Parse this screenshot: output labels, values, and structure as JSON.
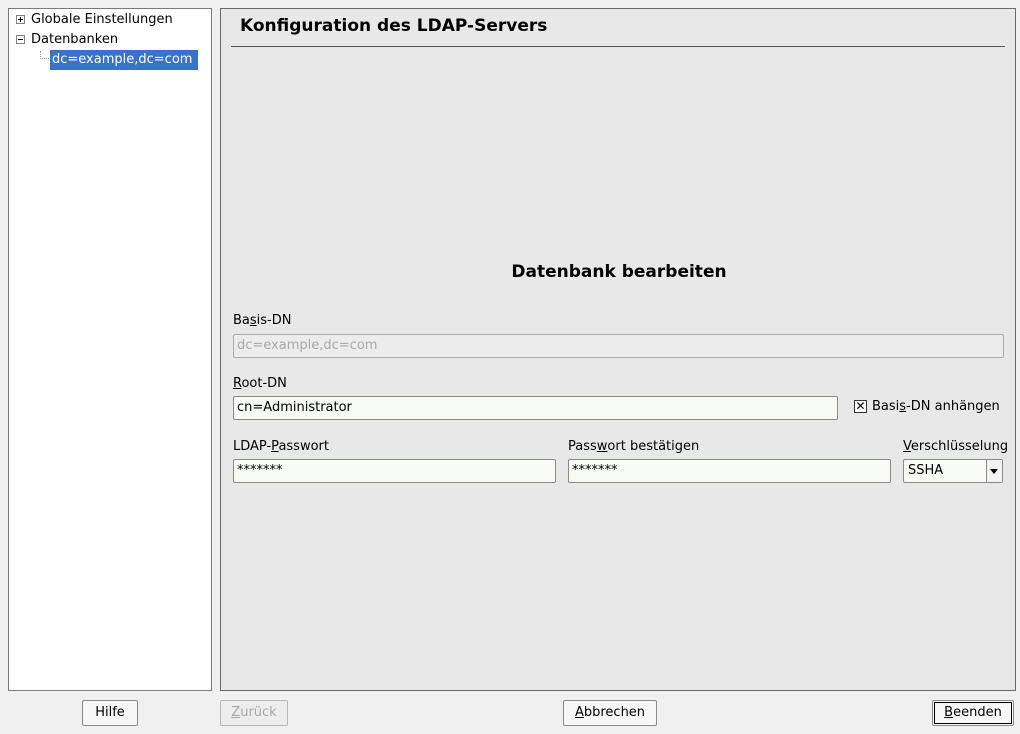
{
  "tree": {
    "items": [
      {
        "label": "Globale Einstellungen",
        "expander": "plus"
      },
      {
        "label": "Datenbanken",
        "expander": "minus"
      },
      {
        "label": "dc=example,dc=com",
        "selected": true
      }
    ]
  },
  "content": {
    "title": "Konfiguration des LDAP-Servers",
    "section_heading": "Datenbank bearbeiten",
    "basis_dn": {
      "label_pre": "Ba",
      "label_mnemonic": "s",
      "label_post": "is-DN",
      "value": "dc=example,dc=com"
    },
    "root_dn": {
      "label_pre": "",
      "label_mnemonic": "R",
      "label_post": "oot-DN",
      "value": "cn=Administrator"
    },
    "append_basis_dn": {
      "label_pre": "Basi",
      "label_mnemonic": "s",
      "label_post": "-DN anhängen",
      "checked": true,
      "check_glyph": "✕"
    },
    "ldap_password": {
      "label_pre": "LDAP-",
      "label_mnemonic": "P",
      "label_post": "asswort",
      "value": "*******"
    },
    "confirm_password": {
      "label_pre": "Pass",
      "label_mnemonic": "w",
      "label_post": "ort bestätigen",
      "value": "*******"
    },
    "encryption": {
      "label_pre": "",
      "label_mnemonic": "V",
      "label_post": "erschlüsselung",
      "value": "SSHA"
    }
  },
  "buttons": {
    "help": "Hilfe",
    "back_mnemonic": "Z",
    "back_rest": "urück",
    "cancel_mnemonic": "A",
    "cancel_rest": "bbrechen",
    "finish_mnemonic": "B",
    "finish_rest": "eenden"
  },
  "colors": {
    "selection": "#3a72c8",
    "panel_background": "#e8e8e8",
    "window_background": "#f0f0f0"
  }
}
